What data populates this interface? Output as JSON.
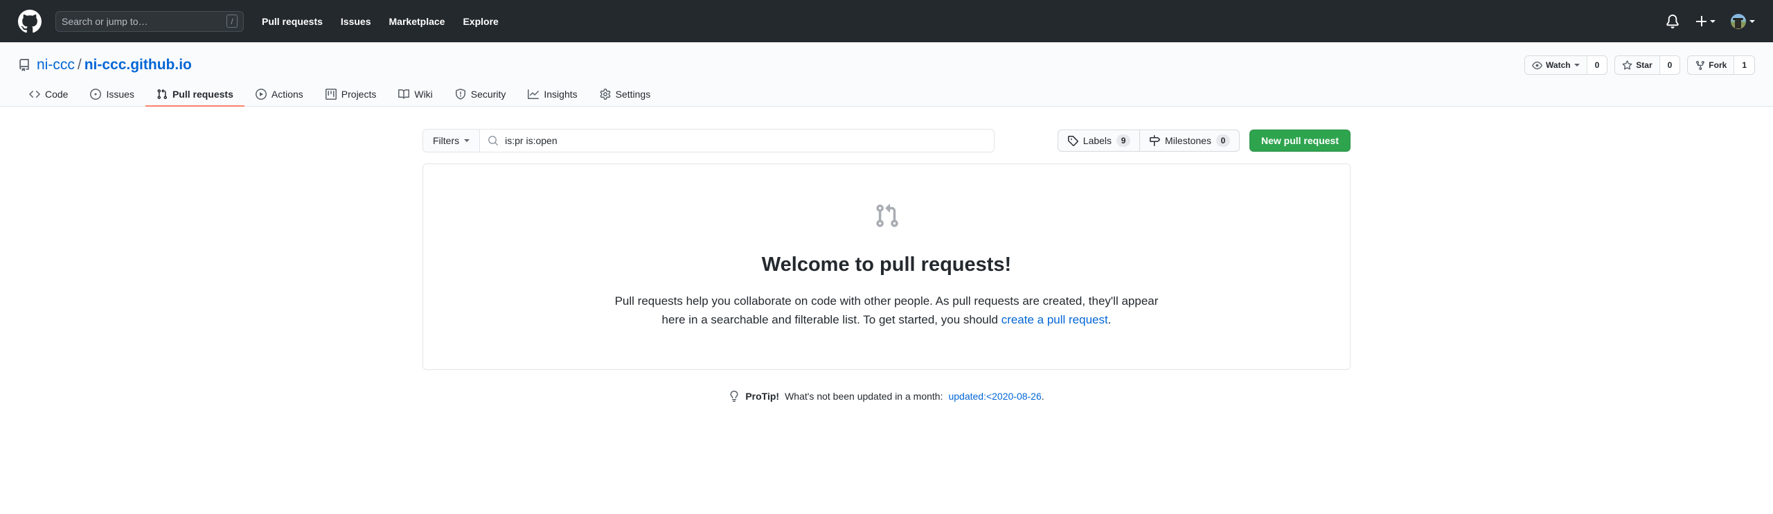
{
  "header": {
    "logo_icon": "github-mark-icon",
    "search": {
      "placeholder": "Search or jump to…",
      "shortcut": "/"
    },
    "nav": [
      {
        "label": "Pull requests"
      },
      {
        "label": "Issues"
      },
      {
        "label": "Marketplace"
      },
      {
        "label": "Explore"
      }
    ],
    "notifications_icon": "bell-icon",
    "create_new_icon": "plus-icon",
    "avatar_icon": "user-avatar"
  },
  "repo": {
    "icon": "repo-icon",
    "owner": "ni-ccc",
    "separator": "/",
    "name": "ni-ccc.github.io",
    "actions": [
      {
        "label": "Watch",
        "count": "0",
        "icon": "eye-icon",
        "has_caret": true
      },
      {
        "label": "Star",
        "count": "0",
        "icon": "star-icon",
        "has_caret": false
      },
      {
        "label": "Fork",
        "count": "1",
        "icon": "repo-forked-icon",
        "has_caret": false
      }
    ],
    "tabs": [
      {
        "label": "Code",
        "icon": "code-icon",
        "active": false
      },
      {
        "label": "Issues",
        "icon": "issue-opened-icon",
        "active": false
      },
      {
        "label": "Pull requests",
        "icon": "git-pull-request-icon",
        "active": true
      },
      {
        "label": "Actions",
        "icon": "play-icon",
        "active": false
      },
      {
        "label": "Projects",
        "icon": "project-icon",
        "active": false
      },
      {
        "label": "Wiki",
        "icon": "book-icon",
        "active": false
      },
      {
        "label": "Security",
        "icon": "shield-icon",
        "active": false
      },
      {
        "label": "Insights",
        "icon": "graph-icon",
        "active": false
      },
      {
        "label": "Settings",
        "icon": "gear-icon",
        "active": false
      }
    ]
  },
  "toolbar": {
    "filters_label": "Filters",
    "search_icon": "search-icon",
    "search_value": "is:pr is:open",
    "labels": {
      "label": "Labels",
      "count": "9",
      "icon": "tag-icon"
    },
    "milestones": {
      "label": "Milestones",
      "count": "0",
      "icon": "milestone-icon"
    },
    "new_pull_request": "New pull request"
  },
  "blankslate": {
    "icon": "git-pull-request-icon",
    "title": "Welcome to pull requests!",
    "body_before": "Pull requests help you collaborate on code with other people. As pull requests are created, they'll appear here in a searchable and filterable list. To get started, you should ",
    "body_link": "create a pull request",
    "body_after": "."
  },
  "protip": {
    "icon": "light-bulb-icon",
    "label": "ProTip!",
    "text": "What's not been updated in a month:",
    "query": "updated:<2020-08-26",
    "period": "."
  },
  "colors": {
    "header_bg": "#24292e",
    "accent_link": "#0366d6",
    "active_tab_underline": "#f9826c",
    "primary_button": "#2ea44f",
    "border": "#e1e4e8"
  }
}
